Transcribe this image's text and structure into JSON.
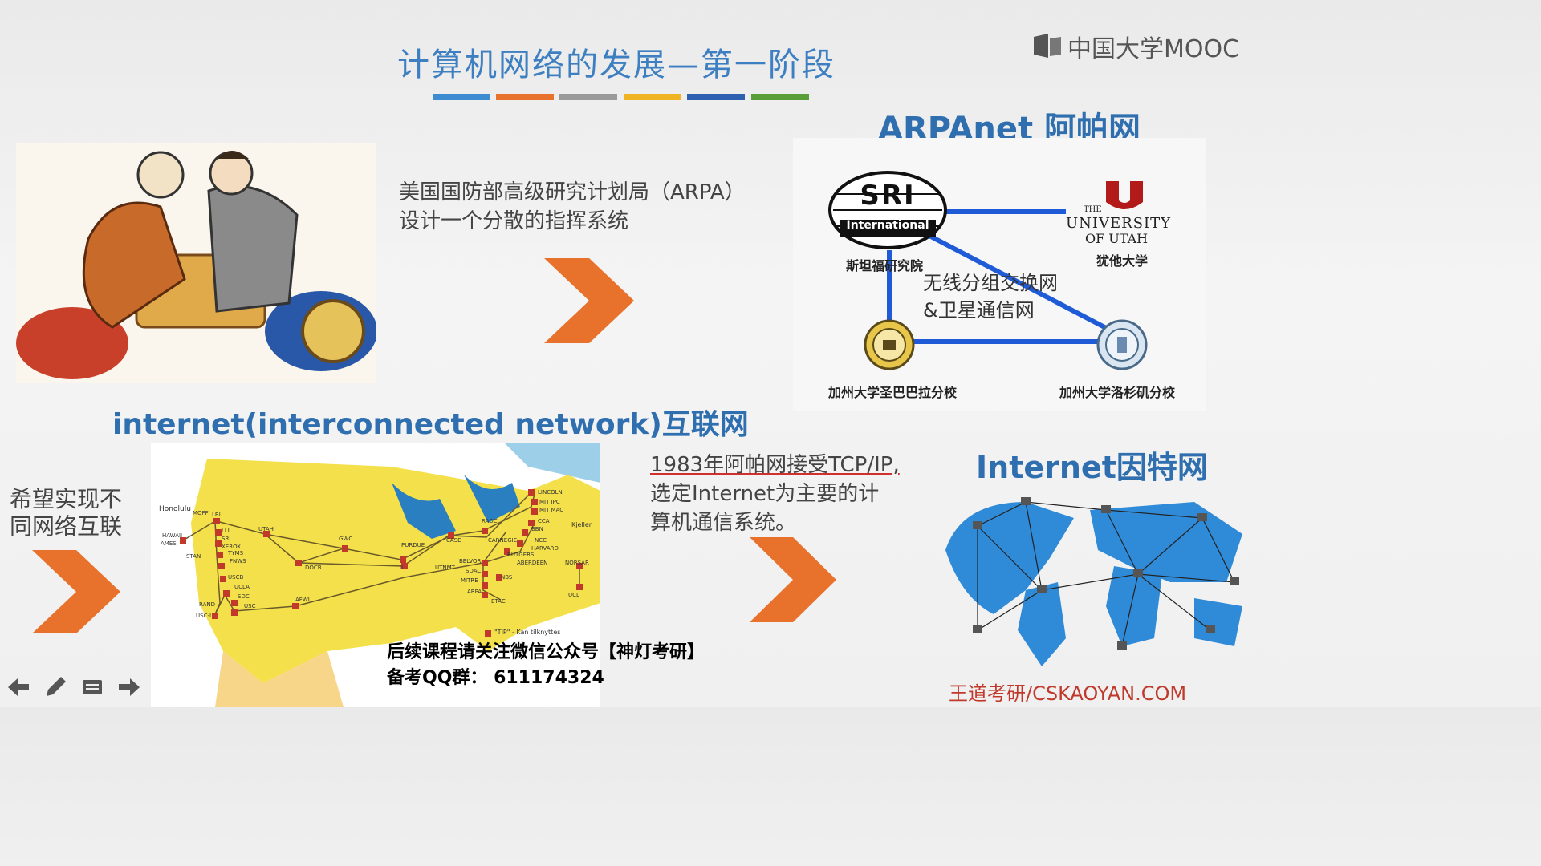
{
  "slide": {
    "title": "计算机网络的发展—第一阶段",
    "colors": {
      "title": "#3d7fc1",
      "accent_blue": "#2f6fb0",
      "chevron": "#e8712b",
      "brand_red": "#c0392b"
    },
    "title_bar_colors": [
      "#3d8bd0",
      "#e8712b",
      "#9a9a9a",
      "#f0b323",
      "#2f5fb0",
      "#5a9e3a"
    ]
  },
  "branding": {
    "platform_logo": "中国大学MOOC",
    "footer_brand": "王道考研/CSKAOYAN.COM"
  },
  "section1": {
    "text_lines": [
      "美国国防部高级研究计划局（ARPA）",
      "设计一个分散的指挥系统"
    ],
    "image_icon": "cold-war-cartoon-icon"
  },
  "arpanet": {
    "heading": "ARPAnet 阿帕网",
    "nodes": {
      "sri": {
        "logo_top": "SRI",
        "logo_bottom": "International",
        "label": "斯坦福研究院"
      },
      "utah": {
        "logo_top": "THE",
        "logo_mid": "UNIVERSITY",
        "logo_of": "OF UTAH",
        "label": "犹他大学"
      },
      "ucsb": {
        "label": "加州大学圣巴巴拉分校"
      },
      "ucla": {
        "label": "加州大学洛杉矶分校"
      }
    },
    "center_text": [
      "无线分组交换网",
      "&卫星通信网"
    ]
  },
  "internet_section": {
    "heading": "internet(interconnected network)互联网",
    "left_text": [
      "希望实现不",
      "同网络互联"
    ],
    "map_icon": "arpanet-us-map-icon"
  },
  "tcp_section": {
    "text_lines": [
      "1983年阿帕网接受TCP/IP,",
      "选定Internet为主要的计",
      "算机通信系统。"
    ]
  },
  "internet_world": {
    "heading": "Internet因特网",
    "map_icon": "world-network-map-icon"
  },
  "footer_tip": {
    "lines": [
      "后续课程请关注微信公众号【神灯考研】",
      "备考QQ群：  611174324"
    ]
  },
  "map_labels": [
    "Honolulu",
    "HAWAII",
    "AMES",
    "MOFF",
    "LBL",
    "LLL",
    "SRI",
    "XEROX",
    "TYMS",
    "FNWS",
    "STAN",
    "USCB",
    "UCLA",
    "SDC",
    "RAND",
    "USC-I",
    "USC",
    "UTAH",
    "GWC",
    "PURDUE",
    "CASE",
    "DOCB",
    "AFWL",
    "IL",
    "UTNMT",
    "LINCOLN",
    "MIT IPC",
    "MIT MAC",
    "CCA",
    "BBN",
    "NCC",
    "HARVARD",
    "RADC",
    "CARNEGIE",
    "RUTGERS",
    "ABERDEEN",
    "BELVOR",
    "SDAC",
    "MITRE",
    "NBS",
    "ARPA",
    "ETAC",
    "NORSAR",
    "UCL",
    "Kjeller",
    "\"TIP\" - Kan tilknyttes"
  ]
}
